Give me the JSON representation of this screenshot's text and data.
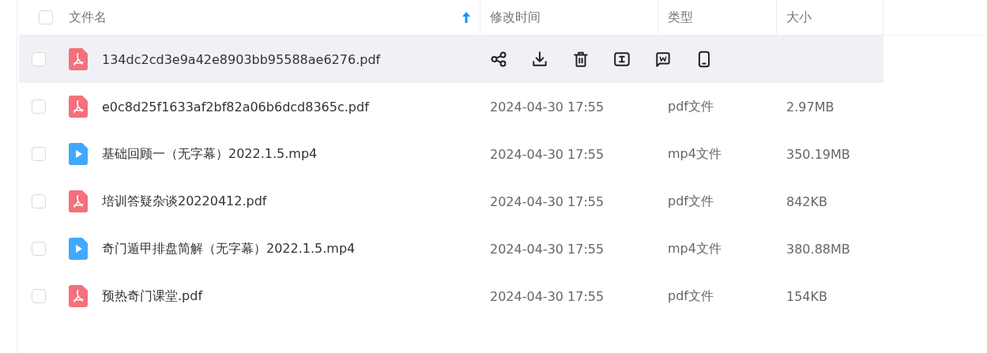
{
  "table": {
    "select_all": {
      "checked": false
    },
    "columns": [
      {
        "label": "文件名",
        "sorted": true
      },
      {
        "label": "修改时间",
        "sorted": false
      },
      {
        "label": "类型",
        "sorted": false
      },
      {
        "label": "大小",
        "sorted": false
      }
    ],
    "rows": [
      {
        "kind": "pdf",
        "name": "134dc2cd3e9a42e8903bb95588ae6276.pdf",
        "hovered": true,
        "checked": false,
        "actions": [
          {
            "kind": "share"
          },
          {
            "kind": "download"
          },
          {
            "kind": "delete"
          },
          {
            "kind": "text"
          },
          {
            "kind": "word"
          },
          {
            "kind": "phone"
          }
        ]
      },
      {
        "kind": "pdf",
        "name": "e0c8d25f1633af2bf82a06b6dcd8365c.pdf",
        "hovered": false,
        "checked": false,
        "modified": "2024-04-30 17:55",
        "type": "pdf文件",
        "size": "2.97MB"
      },
      {
        "kind": "video",
        "name": "基础回顾一（无字幕）2022.1.5.mp4",
        "hovered": false,
        "checked": false,
        "modified": "2024-04-30 17:55",
        "type": "mp4文件",
        "size": "350.19MB"
      },
      {
        "kind": "pdf",
        "name": "培训答疑杂谈20220412.pdf",
        "hovered": false,
        "checked": false,
        "modified": "2024-04-30 17:55",
        "type": "pdf文件",
        "size": "842KB"
      },
      {
        "kind": "video",
        "name": "奇门遁甲排盘简解（无字幕）2022.1.5.mp4",
        "hovered": false,
        "checked": false,
        "modified": "2024-04-30 17:55",
        "type": "mp4文件",
        "size": "380.88MB"
      },
      {
        "kind": "pdf",
        "name": "预热奇门课堂.pdf",
        "hovered": false,
        "checked": false,
        "modified": "2024-04-30 17:55",
        "type": "pdf文件",
        "size": "154KB"
      }
    ]
  }
}
